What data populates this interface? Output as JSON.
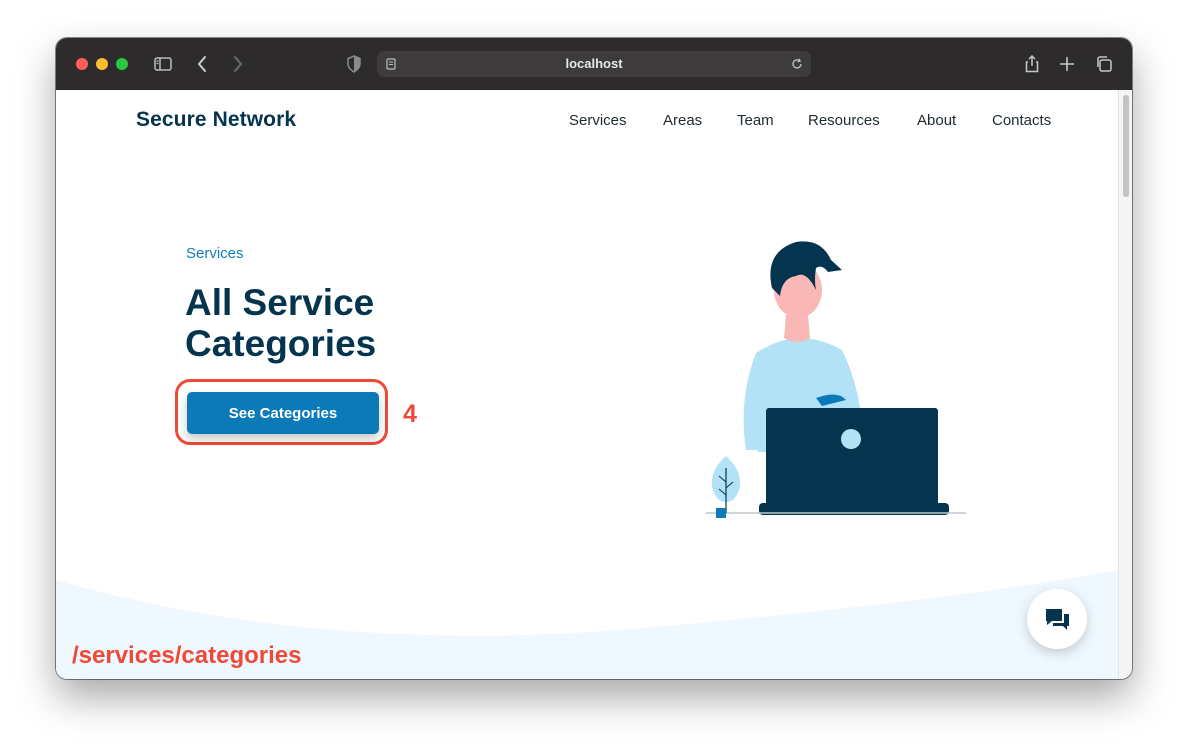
{
  "browser": {
    "address": "localhost",
    "icons": [
      "sidebar-icon",
      "back-icon",
      "forward-icon",
      "shield-icon",
      "page-icon",
      "reload-icon",
      "share-icon",
      "new-tab-icon",
      "tabs-icon"
    ]
  },
  "site": {
    "brand": "Secure Network",
    "nav": [
      "Services",
      "Areas",
      "Team",
      "Resources",
      "About",
      "Contacts"
    ]
  },
  "hero": {
    "eyebrow": "Services",
    "title": "All Service Categories",
    "cta_label": "See Categories"
  },
  "annotation": {
    "step_number": "4",
    "route": "/services/categories",
    "color": "#ef4a37"
  },
  "colors": {
    "primary": "#0c7ab8",
    "heading": "#05344f",
    "wave": "#eef8fe"
  }
}
